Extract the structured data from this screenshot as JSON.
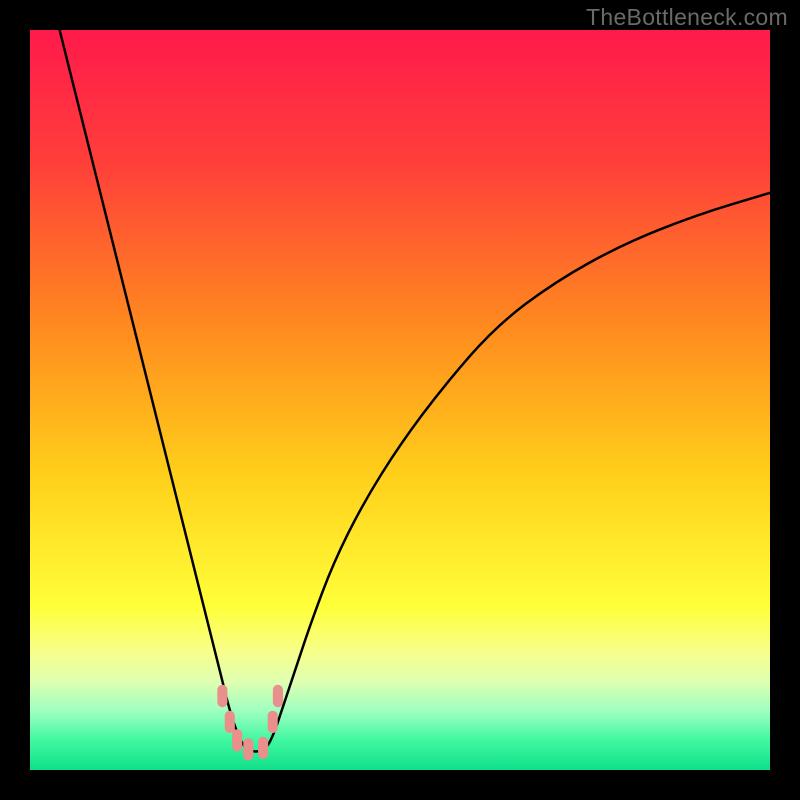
{
  "watermark": "TheBottleneck.com",
  "chart_data": {
    "type": "line",
    "title": "",
    "xlabel": "",
    "ylabel": "",
    "xlim": [
      0,
      100
    ],
    "ylim": [
      0,
      100
    ],
    "background_gradient": {
      "stops": [
        {
          "offset": 0,
          "color": "#ff1a4b"
        },
        {
          "offset": 18,
          "color": "#ff3f3a"
        },
        {
          "offset": 40,
          "color": "#ff8a1f"
        },
        {
          "offset": 60,
          "color": "#ffcf1a"
        },
        {
          "offset": 78,
          "color": "#ffff3a"
        },
        {
          "offset": 84,
          "color": "#f7ff8a"
        },
        {
          "offset": 88,
          "color": "#dfffb0"
        },
        {
          "offset": 92,
          "color": "#9effc0"
        },
        {
          "offset": 96,
          "color": "#40f7a0"
        },
        {
          "offset": 100,
          "color": "#10e08a"
        }
      ]
    },
    "series": [
      {
        "name": "bottleneck-curve",
        "stroke": "#000000",
        "stroke_width": 2.5,
        "x": [
          4,
          6,
          8,
          10,
          12,
          14,
          16,
          18,
          20,
          22,
          24,
          26,
          27,
          28,
          29,
          30,
          31,
          32,
          33,
          34,
          36,
          38,
          41,
          45,
          50,
          56,
          63,
          71,
          80,
          90,
          100
        ],
        "y": [
          100,
          92,
          84,
          76,
          68,
          60,
          52,
          44,
          36,
          28,
          20,
          12,
          8,
          5,
          3,
          2.5,
          2.5,
          3,
          5,
          8,
          14,
          20,
          28,
          36,
          44,
          52,
          60,
          66,
          71,
          75,
          78
        ]
      }
    ],
    "dip_markers": {
      "color": "#e98f8c",
      "size": 14,
      "points": [
        {
          "x": 26.0,
          "y": 10
        },
        {
          "x": 27.0,
          "y": 6.5
        },
        {
          "x": 28.0,
          "y": 4
        },
        {
          "x": 29.5,
          "y": 2.8
        },
        {
          "x": 31.5,
          "y": 3
        },
        {
          "x": 32.8,
          "y": 6.5
        },
        {
          "x": 33.5,
          "y": 10
        }
      ]
    }
  }
}
